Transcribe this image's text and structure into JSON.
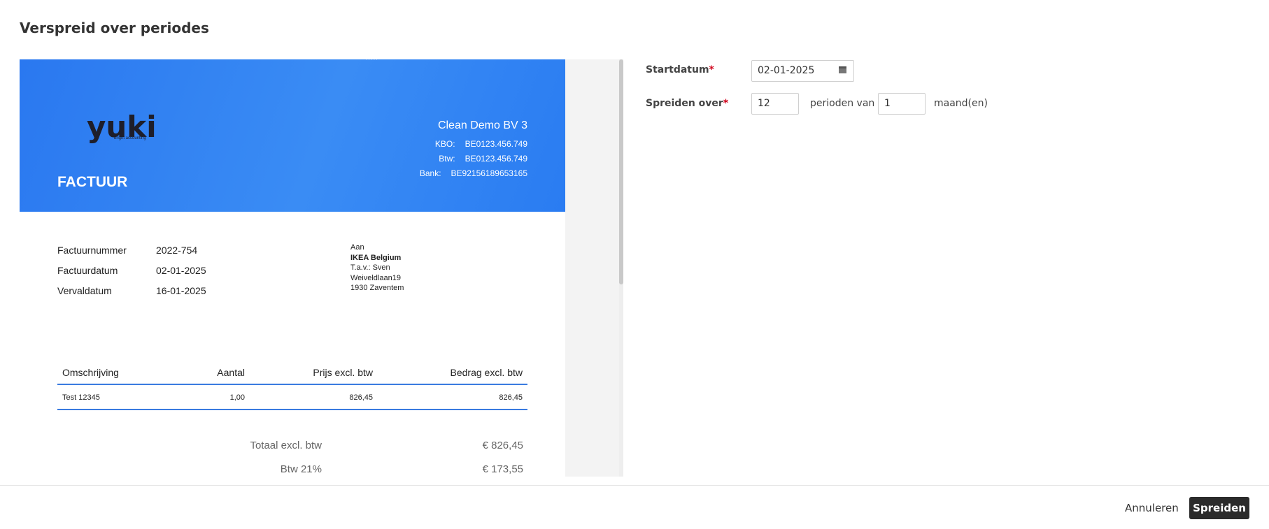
{
  "dialog": {
    "title": "Verspreid over periodes"
  },
  "invoice": {
    "logo": {
      "text": "yuki",
      "tagline": "bright accounting"
    },
    "doc_type": "FACTUUR",
    "company": {
      "name": "Clean Demo BV 3",
      "rows": [
        {
          "label": "KBO:",
          "value": "BE0123.456.749"
        },
        {
          "label": "Btw:",
          "value": "BE0123.456.749"
        },
        {
          "label": "Bank:",
          "value": "BE92156189653165"
        }
      ]
    },
    "meta": [
      {
        "label": "Factuurnummer",
        "value": "2022-754"
      },
      {
        "label": "Factuurdatum",
        "value": "02-01-2025"
      },
      {
        "label": "Vervaldatum",
        "value": "16-01-2025"
      }
    ],
    "recipient": {
      "to_label": "Aan",
      "name": "IKEA Belgium",
      "attention": "T.a.v.: Sven",
      "street": "Weiveldlaan19",
      "city": "1930 Zaventem"
    },
    "table": {
      "headers": [
        "Omschrijving",
        "Aantal",
        "Prijs excl. btw",
        "Bedrag excl. btw"
      ],
      "rows": [
        [
          "Test 12345",
          "1,00",
          "826,45",
          "826,45"
        ]
      ]
    },
    "totals": [
      {
        "label": "Totaal excl. btw",
        "value": "€ 826,45"
      },
      {
        "label": "Btw 21%",
        "value": "€ 173,55"
      }
    ]
  },
  "form": {
    "start_date": {
      "label": "Startdatum",
      "required_mark": "*",
      "value": "02-01-2025",
      "icon": "calendar-icon"
    },
    "spread": {
      "label": "Spreiden over",
      "required_mark": "*",
      "periods_value": "12",
      "periods_text": "perioden van",
      "interval_value": "1",
      "unit_text": "maand(en)"
    }
  },
  "footer": {
    "cancel_label": "Annuleren",
    "submit_label": "Spreiden"
  },
  "colors": {
    "header_blue": "#2a78f0",
    "table_rule": "#3a7be0",
    "required": "#d0021b",
    "primary_button": "#2b2b2b"
  }
}
